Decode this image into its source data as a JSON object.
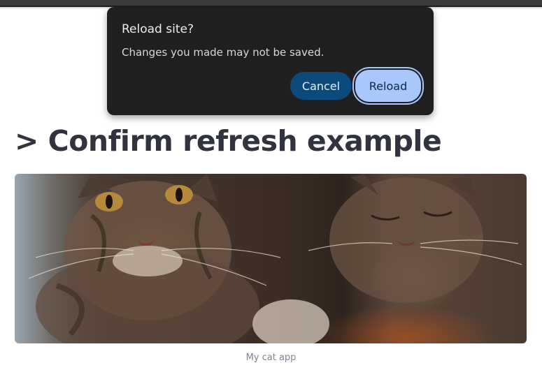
{
  "dialog": {
    "title": "Reload site?",
    "message": "Changes you made may not be saved.",
    "cancel_label": "Cancel",
    "reload_label": "Reload"
  },
  "main": {
    "heading": "> Confirm refresh example",
    "image_alt": "Two tabby cats",
    "caption": "My cat app"
  },
  "colors": {
    "dialog_bg": "#1f1f1f",
    "cancel_bg": "#0b4a7a",
    "reload_bg": "#a8c7fa",
    "heading_text": "#31333f",
    "caption_text": "#808495"
  }
}
